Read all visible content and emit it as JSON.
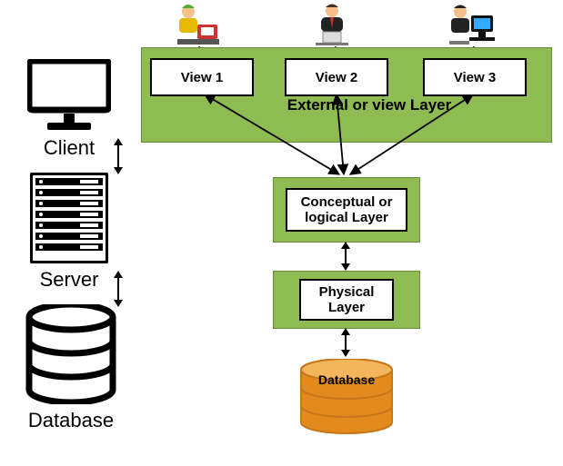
{
  "left": {
    "client_label": "Client",
    "server_label": "Server",
    "database_label": "Database"
  },
  "external": {
    "panel_label": "External or view Layer",
    "views": [
      "View 1",
      "View 2",
      "View 3"
    ]
  },
  "conceptual": {
    "label": "Conceptual or logical Layer"
  },
  "physical": {
    "label": "Physical Layer"
  },
  "database_right": {
    "label": "Database",
    "color": "#e28a1c"
  }
}
